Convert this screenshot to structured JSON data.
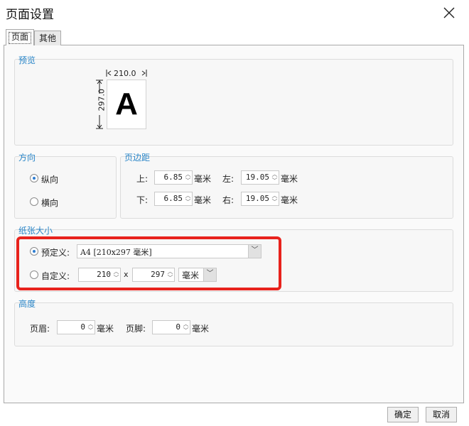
{
  "window": {
    "title": "页面设置"
  },
  "tabs": [
    {
      "label": "页面"
    },
    {
      "label": "其他"
    }
  ],
  "preview": {
    "label": "预览",
    "width": "210.0",
    "height": "297.0",
    "letter": "A"
  },
  "orientation": {
    "label": "方向",
    "portrait": "纵向",
    "landscape": "横向",
    "selected": "纵向"
  },
  "margins": {
    "label": "页边距",
    "top_label": "上:",
    "top_value": "6.85",
    "left_label": "左:",
    "left_value": "19.05",
    "bottom_label": "下:",
    "bottom_value": "6.85",
    "right_label": "右:",
    "right_value": "19.05",
    "unit": "毫米"
  },
  "paper": {
    "label": "纸张大小",
    "predefined_label": "预定义:",
    "predefined_value": "A4 [210x297 毫米]",
    "custom_label": "自定义:",
    "custom_width": "210",
    "x_sep": "x",
    "custom_height": "297",
    "custom_unit": "毫米",
    "selected": "预定义"
  },
  "height": {
    "label": "高度",
    "header_label": "页眉:",
    "header_value": "0",
    "footer_label": "页脚:",
    "footer_value": "0",
    "unit": "毫米"
  },
  "buttons": {
    "ok": "确定",
    "cancel": "取消"
  },
  "colors": {
    "accent": "#2a86c8",
    "highlight": "#e8221c",
    "radio_dot": "#2e7dd1"
  },
  "icons": {
    "close": "close-icon",
    "spin": "spin-up-down-icon",
    "dropdown": "chevron-down-icon"
  }
}
